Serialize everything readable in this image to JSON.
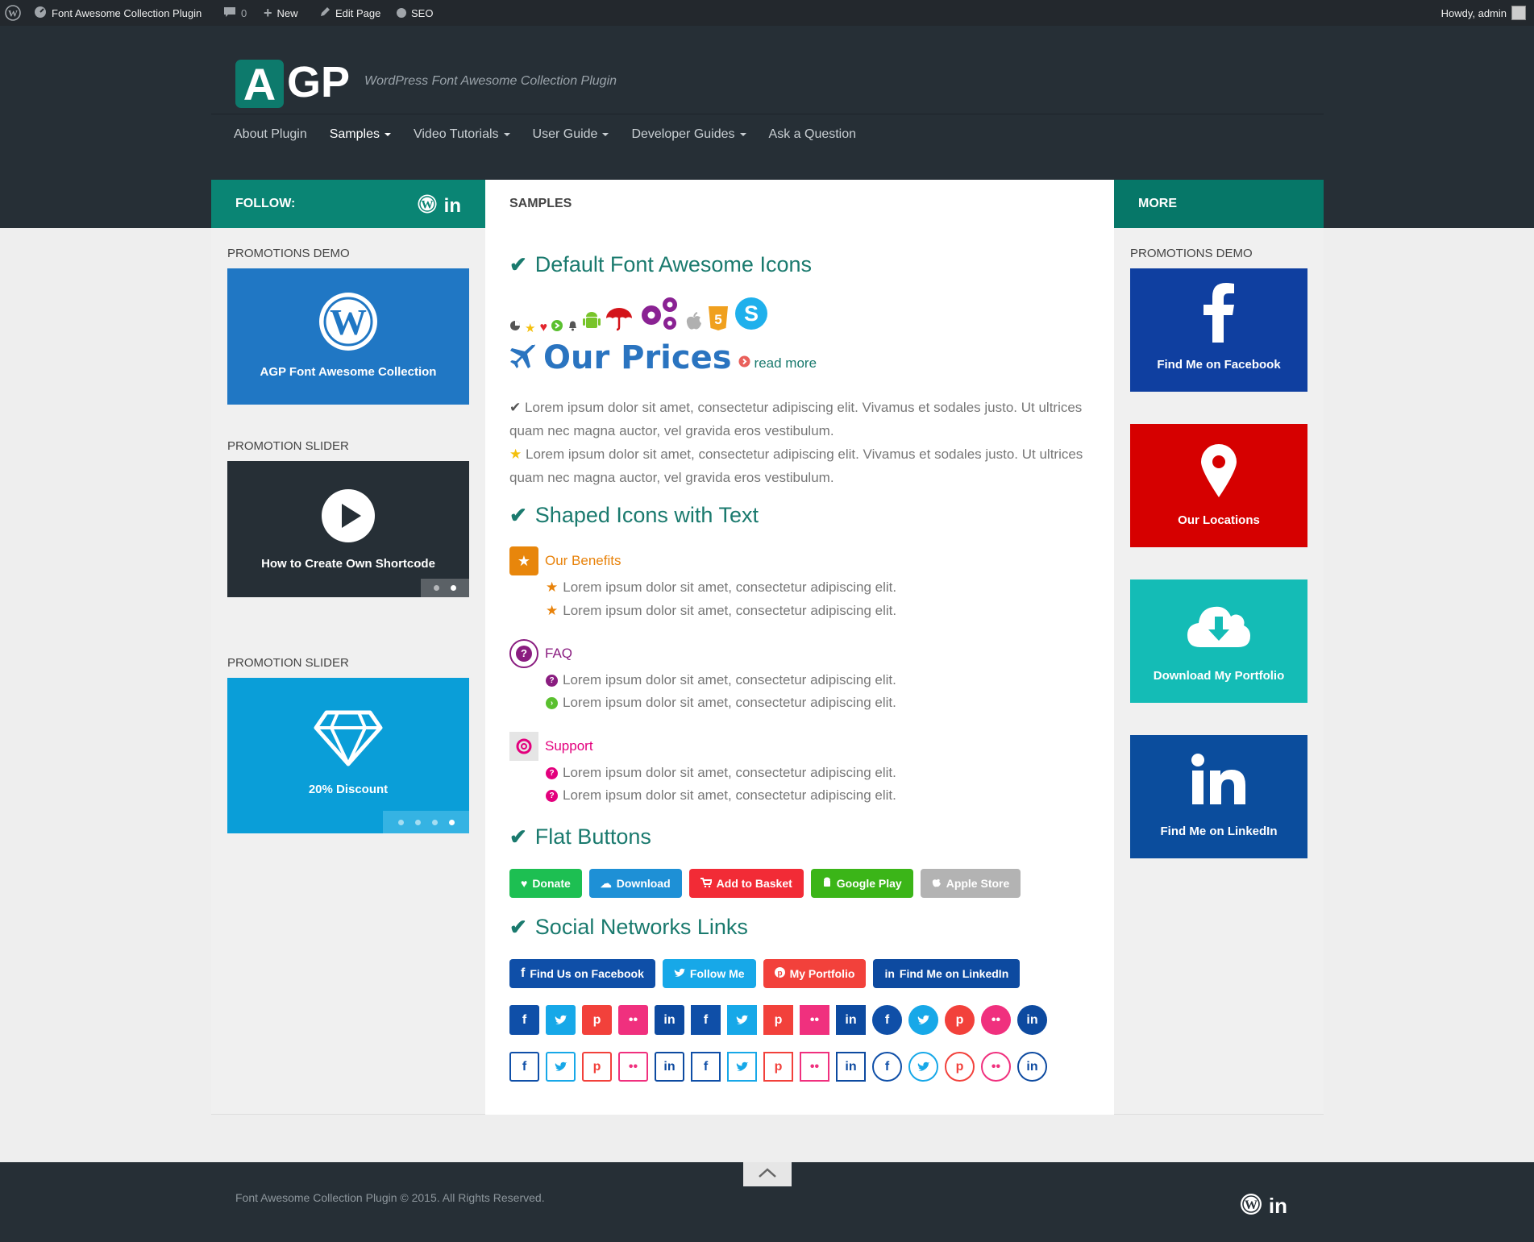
{
  "adminbar": {
    "site_name": "Font Awesome Collection Plugin",
    "comments_count": "0",
    "new_label": "New",
    "edit_label": "Edit Page",
    "seo_label": "SEO",
    "howdy": "Howdy, admin"
  },
  "header": {
    "logo_letter": "A",
    "logo_text": "GP",
    "tagline": "WordPress Font Awesome Collection Plugin"
  },
  "nav": {
    "items": [
      {
        "label": "About Plugin"
      },
      {
        "label": "Samples"
      },
      {
        "label": "Video Tutorials"
      },
      {
        "label": "User Guide"
      },
      {
        "label": "Developer Guides"
      },
      {
        "label": "Ask a Question"
      }
    ]
  },
  "bars": {
    "follow": "FOLLOW:",
    "samples": "SAMPLES",
    "more": "MORE"
  },
  "left_sidebar": {
    "widget1_title": "PROMOTIONS DEMO",
    "promo1_label": "AGP Font Awesome Collection",
    "widget2_title": "PROMOTION SLIDER",
    "promo2_label": "How to Create Own Shortcode",
    "widget3_title": "PROMOTION SLIDER",
    "promo3_label": "20% Discount"
  },
  "content": {
    "h_default_icons": "Default Font Awesome Icons",
    "h_prices": "Our Prices",
    "read_more": "read more",
    "para1": "Lorem ipsum dolor sit amet, consectetur adipiscing elit. Vivamus et sodales justo. Ut ultrices quam nec magna auctor, vel gravida eros vestibulum.",
    "para2": "Lorem ipsum dolor sit amet, consectetur adipiscing elit. Vivamus et sodales justo. Ut ultrices quam nec magna auctor, vel gravida eros vestibulum.",
    "h_shaped": "Shaped Icons with Text",
    "benefits_title": "Our Benefits",
    "faq_title": "FAQ",
    "support_title": "Support",
    "lorem_short": "Lorem ipsum dolor sit amet, consectetur adipiscing elit.",
    "h_flat": "Flat Buttons",
    "flat_buttons": [
      {
        "label": "Donate",
        "color": "#1dbf52"
      },
      {
        "label": "Download",
        "color": "#1e90d6"
      },
      {
        "label": "Add to Basket",
        "color": "#f22b36"
      },
      {
        "label": "Google Play",
        "color": "#3bb518"
      },
      {
        "label": "Apple Store",
        "color": "#b3b3b3"
      }
    ],
    "h_social": "Social Networks Links",
    "social_buttons": [
      {
        "label": "Find Us on Facebook",
        "color": "#0f4fa8"
      },
      {
        "label": "Follow Me",
        "color": "#17a8e8"
      },
      {
        "label": "My Portfolio",
        "color": "#f2413b"
      },
      {
        "label": "Find Me on LinkedIn",
        "color": "#0d4aa0"
      }
    ]
  },
  "right_sidebar": {
    "widget_title": "PROMOTIONS DEMO",
    "promos": [
      {
        "label": "Find Me on Facebook",
        "color": "#0f3fa0"
      },
      {
        "label": "Our Locations",
        "color": "#d60000"
      },
      {
        "label": "Download My Portfolio",
        "color": "#14bcb6"
      },
      {
        "label": "Find Me on LinkedIn",
        "color": "#0b4d9d"
      }
    ]
  },
  "footer": {
    "copyright": "Font Awesome Collection Plugin © 2015. All Rights Reserved."
  },
  "colors": {
    "accent": "#0a8574",
    "dark": "#262f36"
  }
}
